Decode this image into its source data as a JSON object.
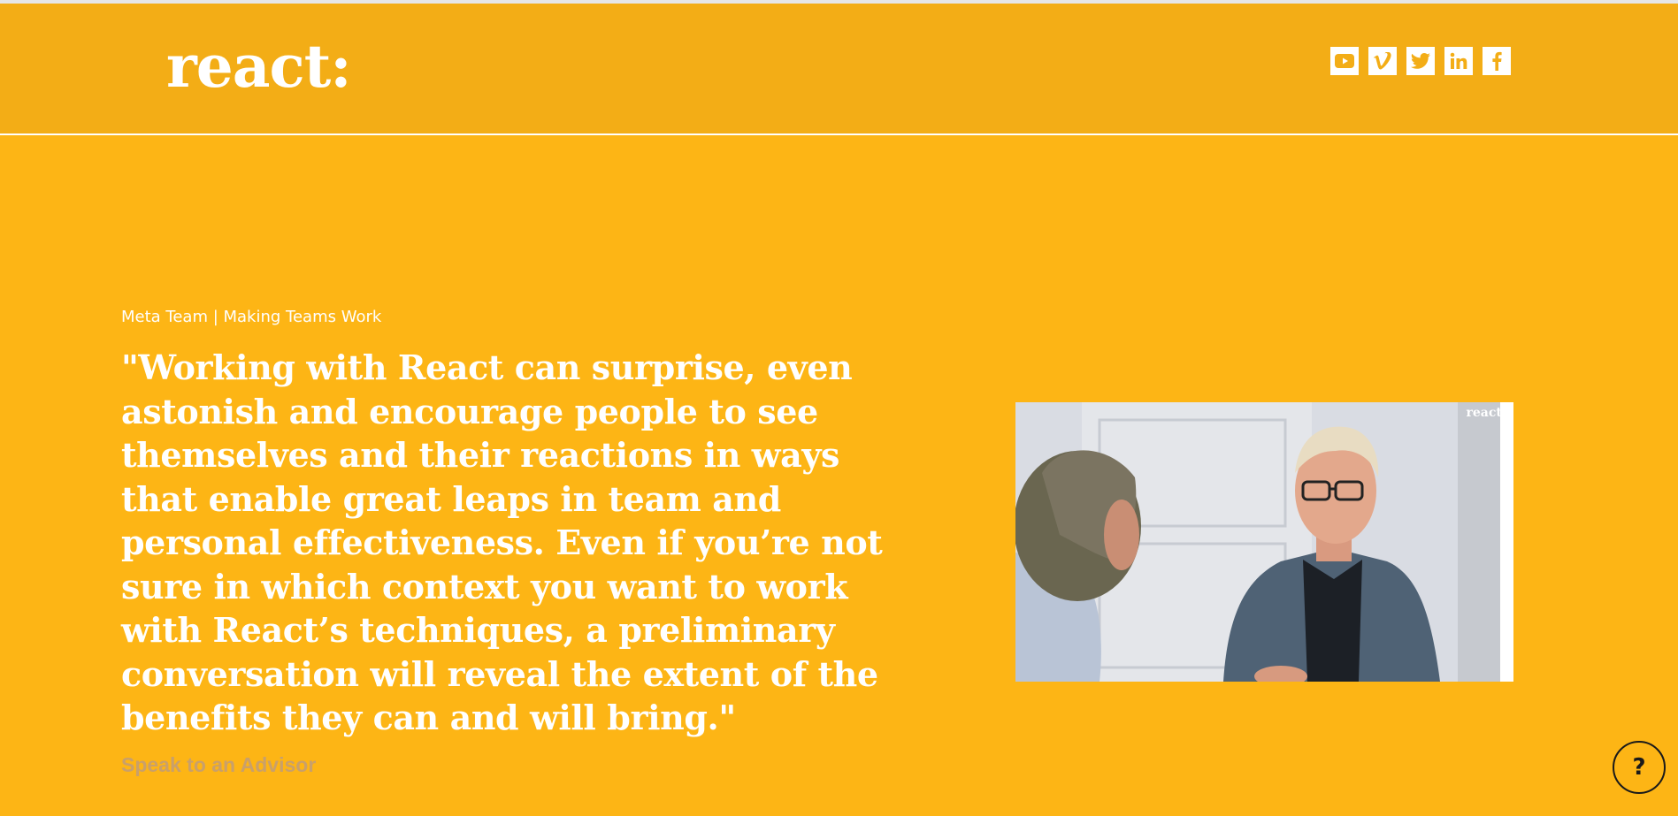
{
  "header": {
    "logo_text": "react:",
    "social": [
      {
        "name": "youtube-icon",
        "label": "YouTube"
      },
      {
        "name": "vimeo-icon",
        "label": "Vimeo"
      },
      {
        "name": "twitter-icon",
        "label": "Twitter"
      },
      {
        "name": "linkedin-icon",
        "label": "LinkedIn"
      },
      {
        "name": "facebook-icon",
        "label": "Facebook"
      }
    ]
  },
  "main": {
    "eyebrow": "Meta Team | Making Teams Work",
    "quote": "\"Working with React can surprise, even astonish and encourage people to see themselves and their reactions in ways that enable great leaps in team and personal effectiveness. Even if you’re not sure in which context you want to work with React’s techniques, a preliminary conversation will reveal the extent of the benefits they can and will bring.\"",
    "cta_label": "Speak to an Advisor",
    "video_watermark": "react:"
  },
  "help": {
    "label": "?"
  },
  "colors": {
    "background": "#fdb515",
    "header_background": "#f3ad16",
    "text": "#ffffff",
    "cta": "#c9a06a"
  }
}
